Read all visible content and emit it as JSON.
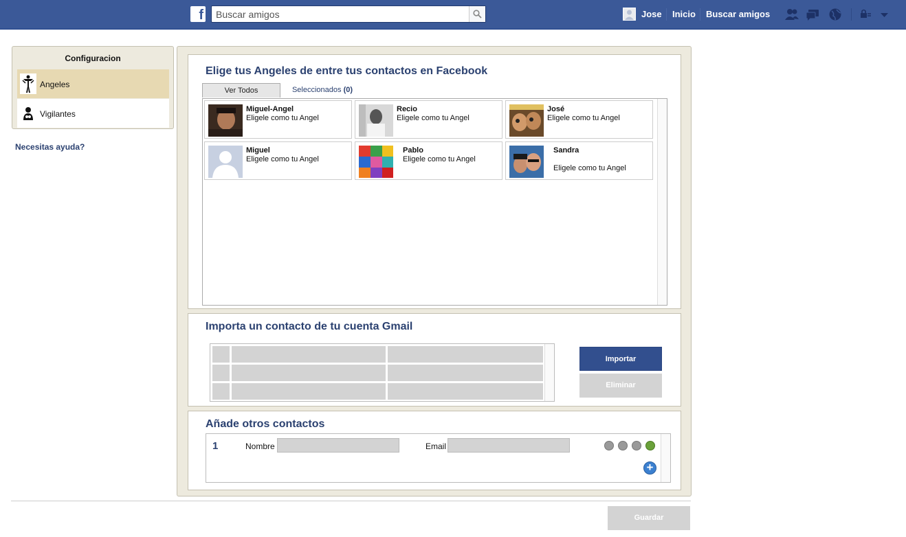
{
  "topbar": {
    "logo": "f",
    "search_placeholder": "Buscar amigos",
    "user_name": "Jose",
    "nav_home": "Inicio",
    "nav_find_friends": "Buscar amigos",
    "icons": [
      "friend-requests-icon",
      "messages-icon",
      "notifications-globe-icon",
      "privacy-shortcuts-icon",
      "account-menu-icon"
    ]
  },
  "sidebar": {
    "title": "Configuracion",
    "items": [
      {
        "label": "Angeles",
        "active": true,
        "icon": "angel-figure-icon"
      },
      {
        "label": "Vigilantes",
        "active": false,
        "icon": "guardian-icon"
      }
    ],
    "help": "Necesitas ayuda?"
  },
  "facebook_section": {
    "title": "Elige tus Angeles de entre tus contactos en Facebook",
    "tab_all": "Ver Todos",
    "tab_selected_prefix": "Seleccionados ",
    "tab_selected_count": "(0)",
    "contacts": [
      {
        "name": "Miguel-Angel",
        "action": "Eligele como tu Angel"
      },
      {
        "name": "Recio",
        "action": "Eligele como tu Angel"
      },
      {
        "name": "José",
        "action": "Eligele como tu Angel"
      },
      {
        "name": "Miguel",
        "action": "Eligele como tu Angel"
      },
      {
        "name": "Pablo",
        "action": "Eligele como tu Angel"
      },
      {
        "name": "Sandra",
        "action": "Eligele como tu Angel"
      }
    ]
  },
  "gmail_section": {
    "title": "Importa un contacto de tu cuenta Gmail",
    "import_button": "Importar",
    "delete_button": "Eliminar"
  },
  "other_section": {
    "title": "Añade otros contactos",
    "row_number": "1",
    "name_label": "Nombre",
    "email_label": "Email"
  },
  "footer": {
    "save_button": "Guardar"
  },
  "colors": {
    "topbar": "#3b5998",
    "panel_bg": "#edeade",
    "heading": "#2b4170",
    "primary_button": "#324f8e",
    "disabled_button": "#d3d3d3"
  }
}
